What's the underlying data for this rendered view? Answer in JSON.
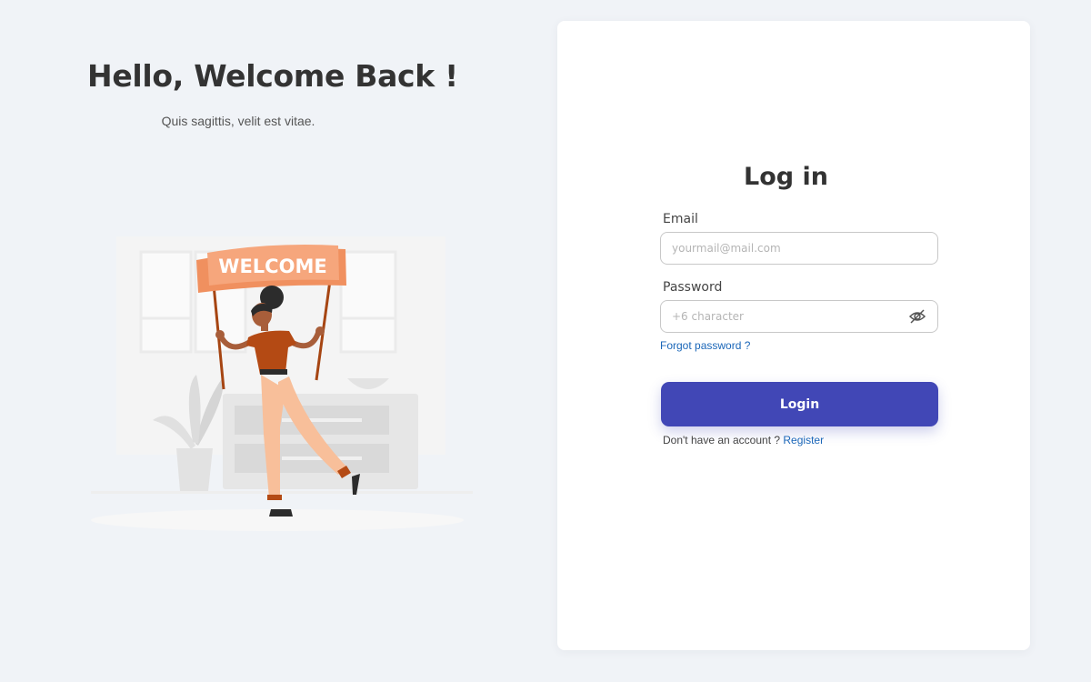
{
  "hero": {
    "title": "Hello, Welcome Back !",
    "subtitle": "Quis sagittis, velit est vitae.",
    "banner_text": "WELCOME"
  },
  "login": {
    "title": "Log in",
    "email_label": "Email",
    "email_placeholder": "yourmail@mail.com",
    "email_value": "",
    "password_label": "Password",
    "password_placeholder": "+6 character",
    "password_value": "",
    "password_toggle_icon": "eye-off-icon",
    "forgot_password": "Forgot password ?",
    "submit_label": "Login",
    "no_account_text": "Don't have an account ?",
    "register_link": "Register"
  },
  "colors": {
    "background": "#f0f3f7",
    "card": "#ffffff",
    "primary": "#4147b6",
    "link": "#1a66b8",
    "banner": "#f6a67c",
    "shirt": "#b44a14",
    "pants": "#f8bf9a"
  }
}
